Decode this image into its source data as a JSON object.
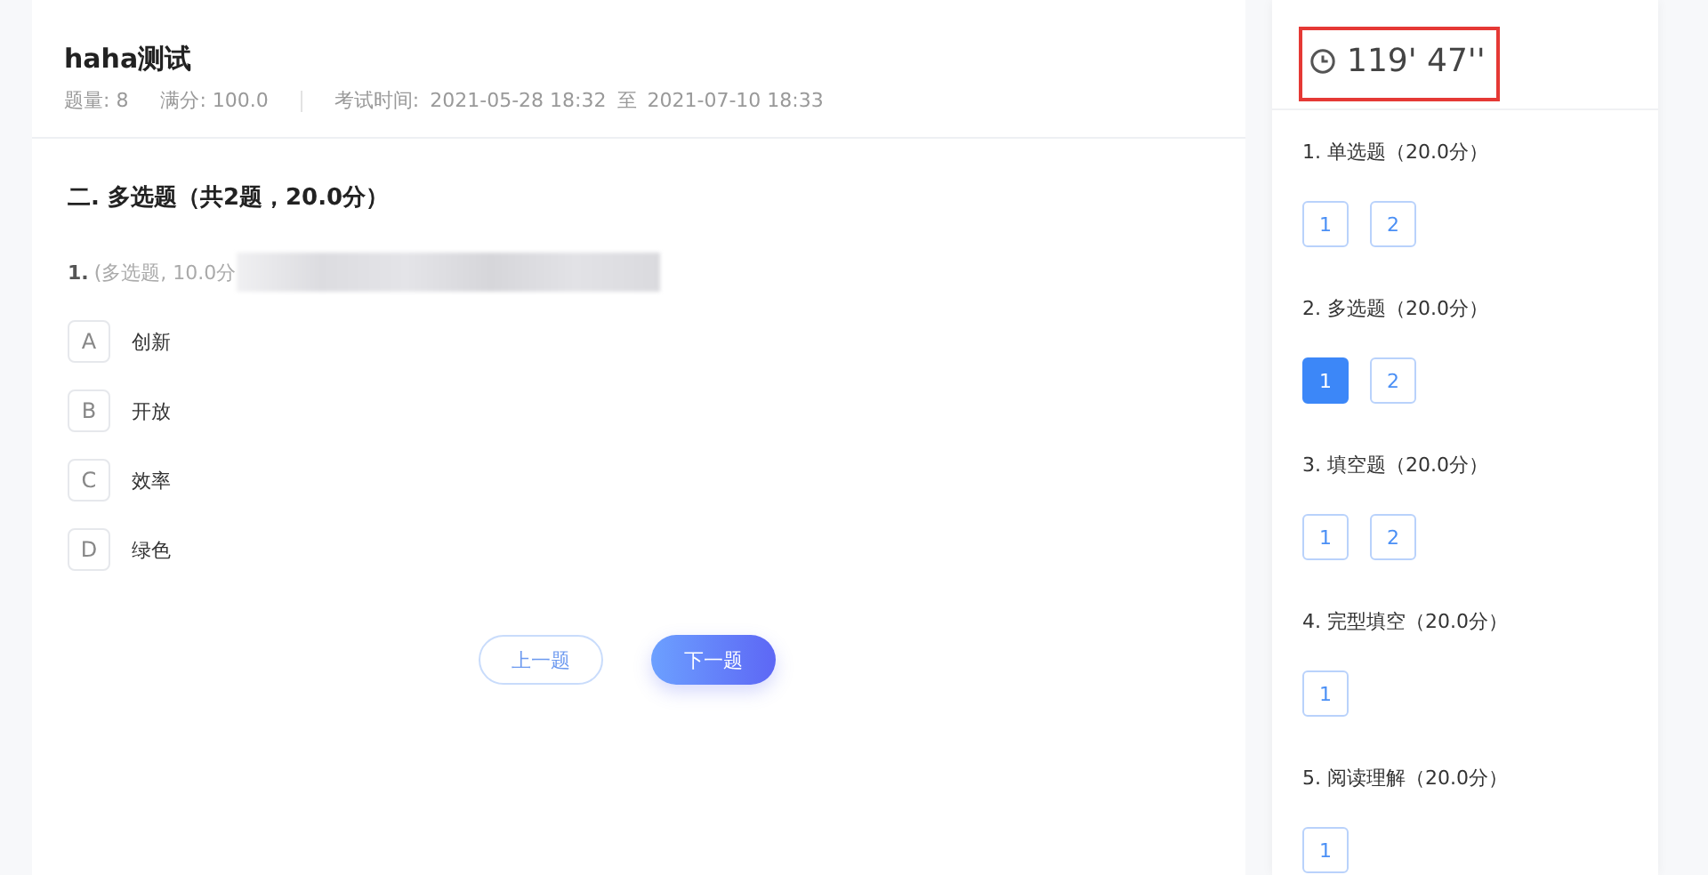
{
  "exam": {
    "title": "haha测试",
    "meta": [
      "题量: 8",
      "满分: 100.0"
    ],
    "time_label": "考试时间:",
    "start": "2021-05-28 18:32",
    "to": "至",
    "end": "2021-07-10 18:33"
  },
  "section": {
    "title": "二. 多选题（共2题，20.0分）"
  },
  "question": {
    "number": "1.",
    "info": "(多选题, 10.0分",
    "options": [
      {
        "letter": "A",
        "text": "创新"
      },
      {
        "letter": "B",
        "text": "开放"
      },
      {
        "letter": "C",
        "text": "效率"
      },
      {
        "letter": "D",
        "text": "绿色"
      }
    ]
  },
  "buttons": [
    {
      "kind": "outline",
      "label": "上一题"
    },
    {
      "kind": "primary",
      "label": "下一题"
    }
  ],
  "timer": {
    "text": "119' 47''"
  },
  "answer_card": [
    {
      "label": "1. 单选题（20.0分）",
      "items": [
        {
          "label": "1",
          "selected": false
        },
        {
          "label": "2",
          "selected": false
        }
      ]
    },
    {
      "label": "2. 多选题（20.0分）",
      "items": [
        {
          "label": "1",
          "selected": true
        },
        {
          "label": "2",
          "selected": false
        }
      ]
    },
    {
      "label": "3. 填空题（20.0分）",
      "items": [
        {
          "label": "1",
          "selected": false
        },
        {
          "label": "2",
          "selected": false
        }
      ]
    },
    {
      "label": "4. 完型填空（20.0分）",
      "items": [
        {
          "label": "1",
          "selected": false
        }
      ]
    },
    {
      "label": "5. 阅读理解（20.0分）",
      "items": [
        {
          "label": "1",
          "selected": false
        }
      ]
    }
  ]
}
